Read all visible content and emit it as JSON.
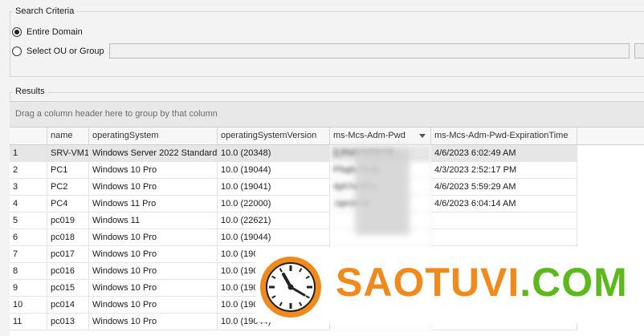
{
  "search_criteria": {
    "title": "Search Criteria",
    "entire_domain_label": "Entire Domain",
    "entire_domain_selected": true,
    "select_ou_label": "Select OU or Group",
    "select_ou_selected": false,
    "ou_value": ""
  },
  "results": {
    "title": "Results",
    "group_panel_text": "Drag a column header here to group by that column",
    "columns": [
      "",
      "name",
      "operatingSystem",
      "operatingSystemVersion",
      "ms-Mcs-Adm-Pwd",
      "ms-Mcs-Adm-Pwd-ExpirationTime"
    ],
    "sorted_column": "ms-Mcs-Adm-Pwd",
    "rows": [
      {
        "num": "1",
        "name": "SRV-VM1",
        "os": "Windows Server 2022 Standard",
        "ver": "10.0 (20348)",
        "pwd": "Z,Fh4YK2%Y4j",
        "exp": "4/6/2023 6:02:49 AM"
      },
      {
        "num": "2",
        "name": "PC1",
        "os": "Windows 10 Pro",
        "ver": "10.0 (19044)",
        "pwd": "P5q8x7R3b",
        "exp": "4/3/2023 2:52:17 PM"
      },
      {
        "num": "3",
        "name": "PC2",
        "os": "Windows 10 Pro",
        "ver": "10.0 (19041)",
        "pwd": "4yh7w2k9z",
        "exp": "4/6/2023 5:59:29 AM"
      },
      {
        "num": "4",
        "name": "PC4",
        "os": "Windows 11 Pro",
        "ver": "10.0 (22000)",
        "pwd": ";!qm3x%t",
        "exp": "4/6/2023 6:04:14 AM"
      },
      {
        "num": "5",
        "name": "pc019",
        "os": "Windows 11",
        "ver": "10.0 (22621)",
        "pwd": "",
        "exp": ""
      },
      {
        "num": "6",
        "name": "pc018",
        "os": "Windows 10 Pro",
        "ver": "10.0 (19044)",
        "pwd": "",
        "exp": ""
      },
      {
        "num": "7",
        "name": "pc017",
        "os": "Windows 10 Pro",
        "ver": "10.0 (19044)",
        "pwd": "",
        "exp": ""
      },
      {
        "num": "8",
        "name": "pc016",
        "os": "Windows 10 Pro",
        "ver": "10.0 (19044)",
        "pwd": "",
        "exp": ""
      },
      {
        "num": "9",
        "name": "pc015",
        "os": "Windows 10 Pro",
        "ver": "10.0 (19044)",
        "pwd": "",
        "exp": ""
      },
      {
        "num": "10",
        "name": "pc014",
        "os": "Windows 10 Pro",
        "ver": "10.0 (19044)",
        "pwd": "",
        "exp": ""
      },
      {
        "num": "11",
        "name": "pc013",
        "os": "Windows 10 Pro",
        "ver": "10.0 (19044)",
        "pwd": "",
        "exp": ""
      }
    ]
  },
  "watermark": {
    "text_a": "SAOTUVI",
    "text_b": ".COM",
    "colors": {
      "orange": "#f08a1c",
      "green": "#5cb81c"
    }
  }
}
